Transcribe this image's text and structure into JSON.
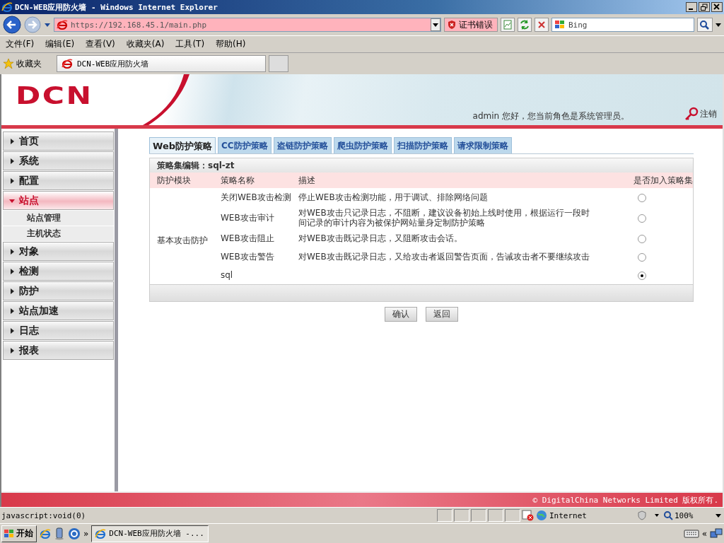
{
  "window": {
    "title": "DCN-WEB应用防火墙 - Windows Internet Explorer"
  },
  "browser": {
    "address": "https://192.168.45.1/main.php",
    "cert_error": "证书错误",
    "search_placeholder": "Bing"
  },
  "menu": [
    "文件(F)",
    "编辑(E)",
    "查看(V)",
    "收藏夹(A)",
    "工具(T)",
    "帮助(H)"
  ],
  "favorites": {
    "label": "收藏夹",
    "tab": "DCN-WEB应用防火墙"
  },
  "header": {
    "logo": "DCN",
    "greeting": "admin 您好，您当前角色是系统管理员。",
    "logout": "注销"
  },
  "sidebar": {
    "items": [
      {
        "label": "首页",
        "expanded": false
      },
      {
        "label": "系统",
        "expanded": false
      },
      {
        "label": "配置",
        "expanded": false
      },
      {
        "label": "站点",
        "expanded": true,
        "children": [
          {
            "label": "站点管理"
          },
          {
            "label": "主机状态"
          }
        ]
      },
      {
        "label": "对象",
        "expanded": false
      },
      {
        "label": "检测",
        "expanded": false
      },
      {
        "label": "防护",
        "expanded": false
      },
      {
        "label": "站点加速",
        "expanded": false
      },
      {
        "label": "日志",
        "expanded": false
      },
      {
        "label": "报表",
        "expanded": false
      }
    ]
  },
  "policy": {
    "tabs": [
      {
        "label": "Web防护策略",
        "selected": true
      },
      {
        "label": "CC防护策略",
        "selected": false
      },
      {
        "label": "盗链防护策略",
        "selected": false
      },
      {
        "label": "爬虫防护策略",
        "selected": false
      },
      {
        "label": "扫描防护策略",
        "selected": false
      },
      {
        "label": "请求限制策略",
        "selected": false
      }
    ],
    "title": "策略集编辑：sql-zt",
    "columns": [
      "防护模块",
      "策略名称",
      "描述",
      "是否加入策略集"
    ],
    "group": "基本攻击防护",
    "rows": [
      {
        "name": "关闭WEB攻击检测",
        "description": "停止WEB攻击检测功能，用于调试、排除网络问题",
        "selected": false
      },
      {
        "name": "WEB攻击审计",
        "description": "对WEB攻击只记录日志，不阻断，建议设备初始上线时使用，根据运行一段时间记录的审计内容为被保护网站量身定制防护策略",
        "selected": false
      },
      {
        "name": "WEB攻击阻止",
        "description": "对WEB攻击既记录日志，又阻断攻击会话。",
        "selected": false
      },
      {
        "name": "WEB攻击警告",
        "description": "对WEB攻击既记录日志，又给攻击者返回警告页面，告诫攻击者不要继续攻击",
        "selected": false
      },
      {
        "name": "sql",
        "description": "",
        "selected": true
      }
    ],
    "buttons": [
      "确认",
      "返回"
    ]
  },
  "footer": "© DigitalChina Networks Limited 版权所有.",
  "status_bar": {
    "text": "javascript:void(0)",
    "zone": "Internet",
    "zoom": "100%"
  },
  "taskbar": {
    "start": "开始",
    "chevron": "»",
    "task": "DCN-WEB应用防火墙 -...",
    "tray_chevron": "«"
  }
}
